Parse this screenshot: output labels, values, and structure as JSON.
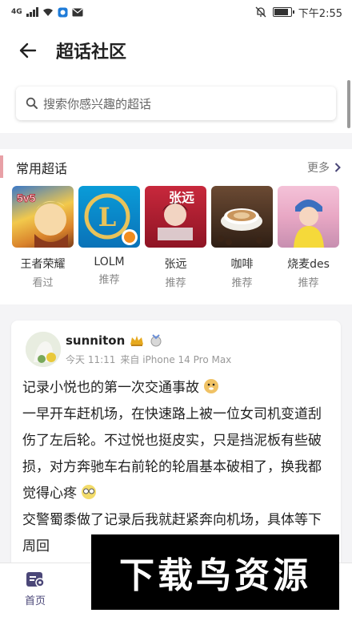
{
  "status_bar": {
    "network": "4G",
    "time": "下午2:55"
  },
  "header": {
    "title": "超话社区"
  },
  "search": {
    "placeholder": "搜索你感兴趣的超话"
  },
  "common": {
    "title": "常用超话",
    "more": "更多",
    "topics": [
      {
        "name": "王者荣耀",
        "sub": "看过",
        "overlay": "5v5"
      },
      {
        "name": "LOLM",
        "sub": "推荐",
        "overlay": "L"
      },
      {
        "name": "张远",
        "sub": "推荐",
        "overlay": "张远"
      },
      {
        "name": "咖啡",
        "sub": "推荐"
      },
      {
        "name": "烧麦des",
        "sub": "推荐"
      }
    ]
  },
  "post": {
    "username": "sunniton",
    "time": "今天 11:11",
    "source": "来自 iPhone 14 Pro Max",
    "lines": [
      "记录小悦也的第一次交通事故",
      "一早开车赶机场，在快速路上被一位女司机变道刮伤了左后轮。不过悦也挺皮实，只是挡泥板有些破损，对方奔驰车右前轮的轮眉基本破相了，换我都觉得心疼",
      "交警蜀黍做了记录后我就赶紧奔向机场，具体等下周回"
    ]
  },
  "tabbar": {
    "home": "首页"
  },
  "watermark": {
    "text": "下载鸟资源"
  },
  "colors": {
    "accent": "#4b4778",
    "section_bar": "#e8a0a6"
  }
}
